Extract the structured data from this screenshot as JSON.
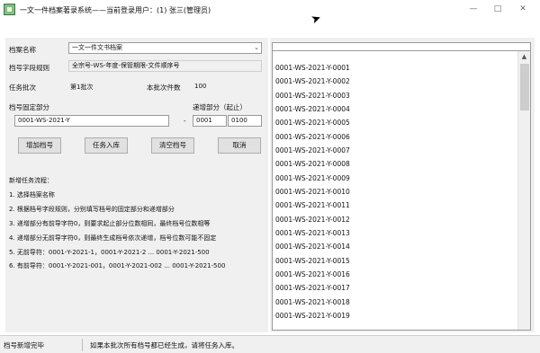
{
  "titlebar": {
    "title": "一文一件档案著录系统——当前登录用户：(1) 张三(管理员)",
    "minimize": "—",
    "maximize": "□",
    "close": "✕"
  },
  "form": {
    "archive_name_label": "档案名称",
    "archive_name_value": "一文一件文书档案",
    "rule_label": "档号字段规则",
    "rule_value": "全宗号-WS-年度-保管期限-文件顺序号",
    "batch_label": "任务批次",
    "batch_value": "第1批次",
    "count_label": "本批次件数",
    "count_value": "100",
    "fixed_label": "档号固定部分",
    "fixed_value": "0001-WS-2021-Y",
    "increment_label": "递增部分（起止）",
    "dash": "-",
    "increment_start": "0001",
    "increment_end": "0100"
  },
  "buttons": {
    "add": "增加档号",
    "enter": "任务入库",
    "clear": "清空档号",
    "cancel": "取消"
  },
  "notes": [
    "新增任务流程：",
    "1. 选择档案名称",
    "2. 根据档号字段规则，分别填写档号的固定部分和递增部分",
    "3. 递增部分有前导字符0，则要求起止部分位数相同，最终档号位数相等",
    "4. 递增部分无前导字符0，则最终生成档号依次递增，档号位数可能不固定",
    "5. 无前导符：0001-Y-2021-1，0001-Y-2021-2 ... 0001-Y-2021-500",
    "6. 有前导符：0001-Y-2021-001，0001-Y-2021-002 ... 0001-Y-2021-500"
  ],
  "list_items": [
    "0001-WS-2021-Y-0001",
    "0001-WS-2021-Y-0002",
    "0001-WS-2021-Y-0003",
    "0001-WS-2021-Y-0004",
    "0001-WS-2021-Y-0005",
    "0001-WS-2021-Y-0006",
    "0001-WS-2021-Y-0007",
    "0001-WS-2021-Y-0008",
    "0001-WS-2021-Y-0009",
    "0001-WS-2021-Y-0010",
    "0001-WS-2021-Y-0011",
    "0001-WS-2021-Y-0012",
    "0001-WS-2021-Y-0013",
    "0001-WS-2021-Y-0014",
    "0001-WS-2021-Y-0015",
    "0001-WS-2021-Y-0016",
    "0001-WS-2021-Y-0017",
    "0001-WS-2021-Y-0018",
    "0001-WS-2021-Y-0019"
  ],
  "status": {
    "left": "档号新增完毕",
    "right": "如果本批次所有档号都已经生成，请将任务入库。"
  },
  "icons": {
    "combo_arrow": "⌄",
    "scroll_up": "▲",
    "cursor": "➤"
  }
}
